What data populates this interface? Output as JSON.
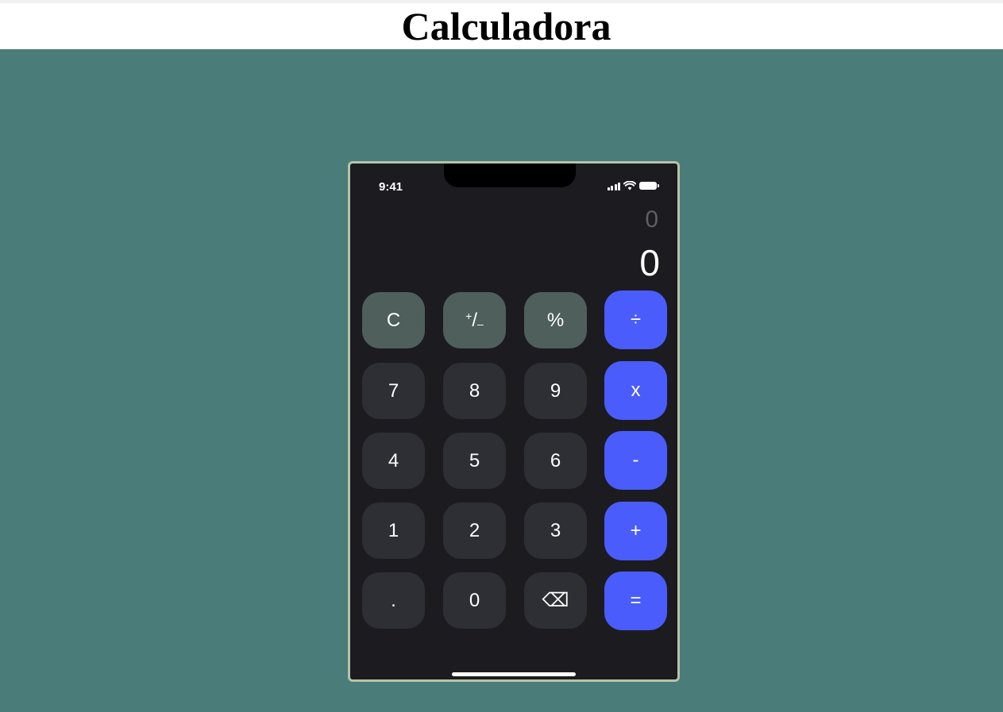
{
  "page": {
    "title": "Calculadora"
  },
  "status_bar": {
    "time": "9:41",
    "icons": [
      "signal-icon",
      "wifi-icon",
      "battery-icon"
    ]
  },
  "display": {
    "previous": "0",
    "current": "0"
  },
  "keys": {
    "clear": "C",
    "sign_plus": "+",
    "sign_slash": "/",
    "sign_minus": "–",
    "percent": "%",
    "divide": "÷",
    "seven": "7",
    "eight": "8",
    "nine": "9",
    "multiply": "x",
    "four": "4",
    "five": "5",
    "six": "6",
    "subtract": "-",
    "one": "1",
    "two": "2",
    "three": "3",
    "add": "+",
    "decimal": ".",
    "zero": "0",
    "backspace": "⌫",
    "equals": "="
  },
  "colors": {
    "background": "#4a7c79",
    "phone": "#1c1b20",
    "number_key": "#2e2e35",
    "function_key": "#4f5f5b",
    "operator_key": "#4a5cfb"
  }
}
